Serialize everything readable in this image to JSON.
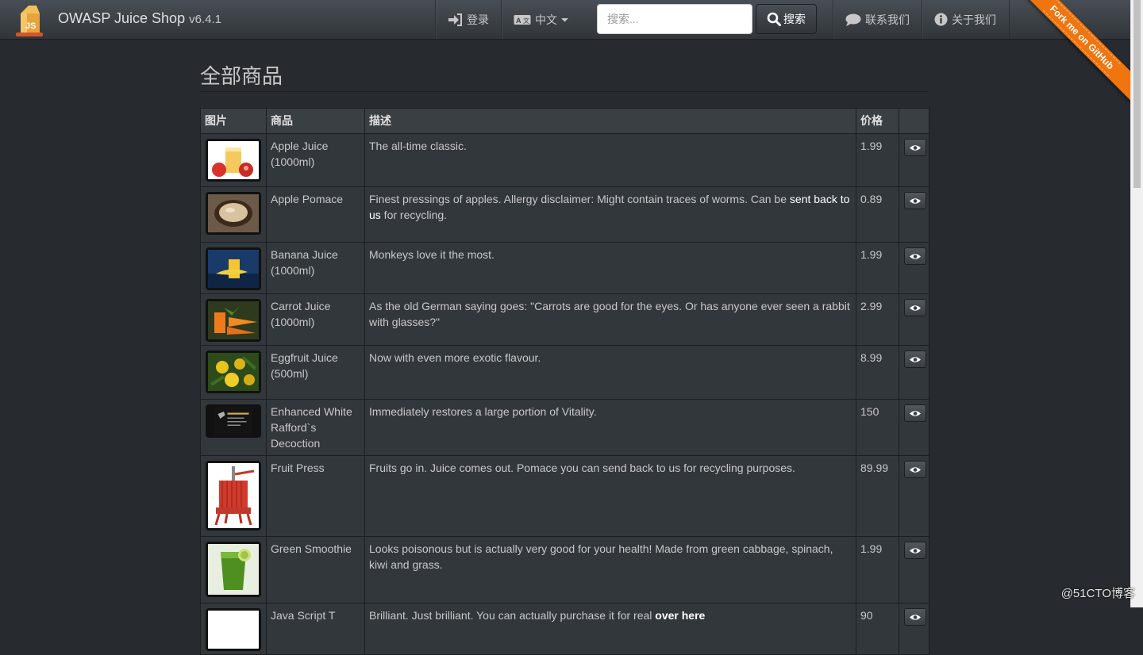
{
  "header": {
    "brand": "OWASP Juice Shop",
    "version": "v6.4.1",
    "login_label": "登录",
    "language_label": "中文",
    "search_placeholder": "搜索...",
    "search_button": "搜索",
    "contact_label": "联系我们",
    "about_label": "关于我们",
    "ribbon_text": "Fork me on GitHub"
  },
  "main": {
    "title": "全部商品",
    "columns": {
      "image": "图片",
      "product": "商品",
      "description": "描述",
      "price": "价格"
    },
    "products": [
      {
        "name": "Apple Juice (1000ml)",
        "desc": "The all-time classic.",
        "price": "1.99"
      },
      {
        "name": "Apple Pomace",
        "desc_pre": "Finest pressings of apples. Allergy disclaimer: Might contain traces of worms. Can be ",
        "desc_link": "sent back to us",
        "desc_post": " for recycling.",
        "price": "0.89"
      },
      {
        "name": "Banana Juice (1000ml)",
        "desc": "Monkeys love it the most.",
        "price": "1.99"
      },
      {
        "name": "Carrot Juice (1000ml)",
        "desc": "As the old German saying goes: \"Carrots are good for the eyes. Or has anyone ever seen a rabbit with glasses?\"",
        "price": "2.99"
      },
      {
        "name": "Eggfruit Juice (500ml)",
        "desc": "Now with even more exotic flavour.",
        "price": "8.99"
      },
      {
        "name": "Enhanced White Rafford`s Decoction",
        "desc": "Immediately restores a large portion of Vitality.",
        "price": "150"
      },
      {
        "name": "Fruit Press",
        "desc": "Fruits go in. Juice comes out. Pomace you can send back to us for recycling purposes.",
        "price": "89.99"
      },
      {
        "name": "Green Smoothie",
        "desc": "Looks poisonous but is actually very good for your health! Made from green cabbage, spinach, kiwi and grass.",
        "price": "1.99"
      },
      {
        "name": "Java Script T",
        "desc_pre": "Brilliant. Just brilliant. You can actually purchase it for real ",
        "desc_link": "over here",
        "desc_post": "",
        "price": "90"
      }
    ]
  },
  "watermark": "@51CTO博客",
  "colors": {
    "background": "#272b30",
    "navbar": "#3a3f44",
    "ribbon": "#f0750f"
  }
}
